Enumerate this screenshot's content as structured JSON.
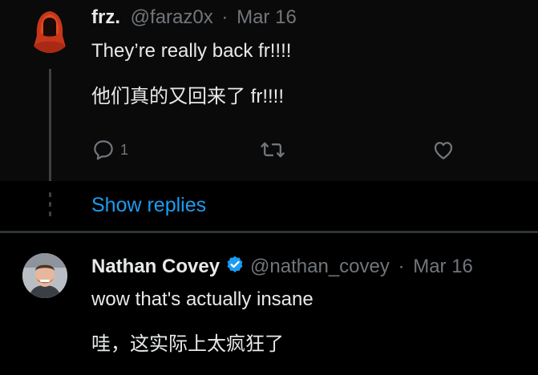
{
  "reply1": {
    "display_name": "frz.",
    "handle": "@faraz0x",
    "separator": "·",
    "date": "Mar 16",
    "text_en": "They’re really back fr!!!!",
    "text_zh": "他们真的又回来了 fr!!!!",
    "reply_count": "1"
  },
  "show_replies": "Show replies",
  "reply2": {
    "display_name": "Nathan Covey",
    "handle": "@nathan_covey",
    "separator": "·",
    "date": "Mar 16",
    "text_en": "wow that's actually insane",
    "text_zh": "哇，这实际上太疯狂了"
  },
  "colors": {
    "background": "#000000",
    "text": "#e7e9ea",
    "muted": "#71767b",
    "accent": "#1d9bf0"
  },
  "icons": [
    "reply-icon",
    "retweet-icon",
    "like-icon",
    "verified-badge-icon"
  ]
}
